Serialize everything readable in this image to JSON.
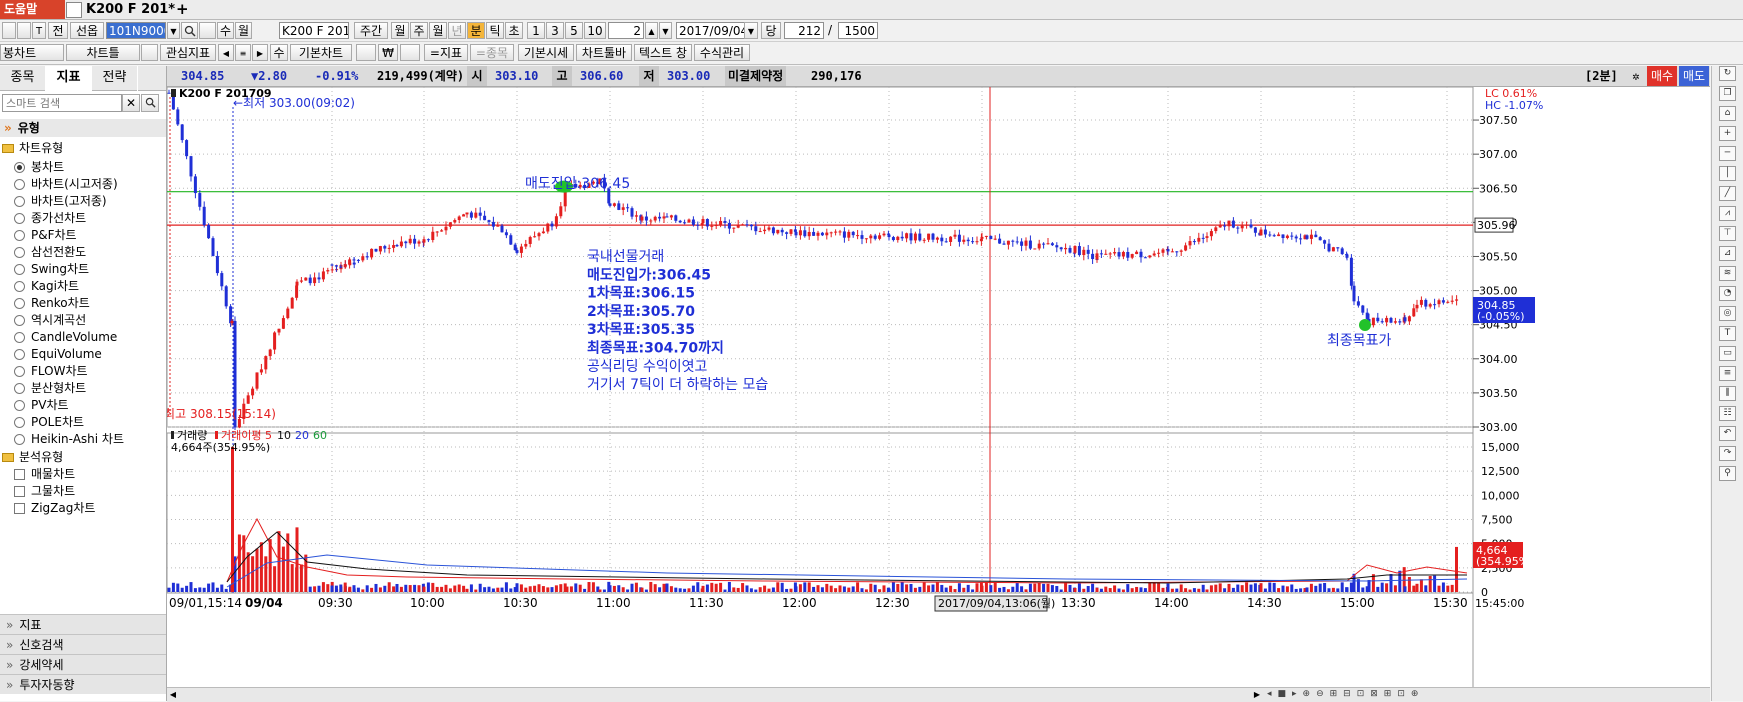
{
  "tabs": {
    "help": "도움말",
    "active": "K200 F 201*",
    "add": "+"
  },
  "toolbar1": {
    "symbol_value": "101N9000",
    "symbol_name": "K200 F 201",
    "period_week": "주간",
    "unit_month": "월",
    "unit_week": "주",
    "unit_day": "월",
    "unit_year": "년",
    "unit_minute": "분",
    "unit_tick": "틱",
    "unit_second": "초",
    "n1": "1",
    "n3": "3",
    "n5": "5",
    "n10": "10",
    "interval": "2",
    "date": "2017/09/04",
    "dang_label": "당",
    "count": "212",
    "slash": "/",
    "total": "1500",
    "jeon": "전",
    "seonop": "선옵",
    "su": "수",
    "wol": "월"
  },
  "toolbar2": {
    "bongchart": "봉차트",
    "charttools": "차트틀",
    "watchlist": "관심지표",
    "su": "수",
    "basic_chart": "기본차트",
    "indicator": "=지표",
    "item": "=종목",
    "basic_quote": "기본시세",
    "chart_toolbar": "차트툴바",
    "text_window": "텍스트 창",
    "formula": "수식관리"
  },
  "left_panel": {
    "tabs": [
      "종목",
      "지표",
      "전략"
    ],
    "search_placeholder": "스마트 검색",
    "section_type": "유형",
    "group_chart_type": "차트유형",
    "chart_types": [
      "봉차트",
      "바차트(시고저종)",
      "바차트(고저종)",
      "종가선차트",
      "P&F차트",
      "삼선전환도",
      "Swing차트",
      "Kagi차트",
      "Renko차트",
      "역시계곡선",
      "CandleVolume",
      "EquiVolume",
      "FLOW차트",
      "분산형차트",
      "PV차트",
      "POLE차트",
      "Heikin-Ashi 차트"
    ],
    "selected_type": "봉차트",
    "group_analysis": "분석유형",
    "analysis_types": [
      "매물차트",
      "그물차트",
      "ZigZag차트"
    ],
    "bottom_items": [
      "지표",
      "신호검색",
      "강세약세",
      "투자자동향"
    ]
  },
  "infobar": {
    "price": "304.85",
    "change": "▼2.80",
    "change_pct": "-0.91%",
    "volume": "219,499(계약)",
    "open_label": "시",
    "open": "303.10",
    "high_label": "고",
    "high": "306.60",
    "low_label": "저",
    "low": "303.00",
    "oi_label": "미결제약정",
    "oi": "290,176",
    "interval_label": "[2분]",
    "buy": "매수",
    "sell": "매도"
  },
  "colors": {
    "up": "#e41f1f",
    "down": "#1f2fd6",
    "annotation": "#1f2fd6",
    "marker": "#22c22a",
    "hline_green": "#21b521",
    "hline_red": "#e02020",
    "price_tag_bg": "#1f2fd6",
    "volume_tag_bg": "#e41f1f"
  },
  "chart": {
    "symbol_label": "K200 F 201709",
    "low_note": "←최저 303.00(09:02)",
    "high_note": "←최고 308.15(15:14)",
    "entry_label": "매도진입:306.45",
    "target_label": "최종목표가",
    "note_lines": [
      "국내선물거래",
      "매도진입가:306.45",
      "1차목표:306.15",
      "2차목표:305.70",
      "3차목표:305.35",
      "최종목표:304.70까지",
      "공식리딩 수익이엿고",
      "거기서 7틱이 더 하락하는 모습"
    ],
    "lc_label": "LC  0.61%",
    "hc_label": "HC -1.07%",
    "price_axis": [
      "307.50",
      "307.00",
      "306.50",
      "306.00",
      "305.50",
      "305.00",
      "304.50",
      "304.00",
      "303.50",
      "303.00"
    ],
    "red_line_tag": "305.96",
    "current_tag_line1": "304.85",
    "current_tag_line2": "(-0.05%)",
    "volume_legend_label": "거래량",
    "volume_ma_label": "거래이평",
    "volume_ma_periods": [
      "5",
      "10",
      "20",
      "60"
    ],
    "volume_value": "4,664주(354.95%)",
    "volume_axis": [
      "15,000",
      "12,500",
      "10,000",
      "7,500",
      "5,000",
      "2,500",
      "0"
    ],
    "volume_tag_line1": "4,664",
    "volume_tag_line2": "(354.95%)",
    "time_axis": [
      "09/01,15:14",
      "09/04",
      "09:30",
      "10:00",
      "10:30",
      "11:00",
      "11:30",
      "12:00",
      "12:30",
      "13:00",
      "13:30",
      "14:00",
      "14:30",
      "15:00",
      "15:30"
    ],
    "crosshair_label": "2017/09/04,13:06(월)",
    "time_end": "15:45:00"
  },
  "chart_data": {
    "type": "candlestick",
    "interval": "2분",
    "ylim": [
      303.0,
      307.75
    ],
    "volume_ylim": [
      0,
      15000
    ],
    "hlines": [
      306.45,
      305.96
    ],
    "series": [
      {
        "name": "price_path",
        "x": [
          "09/01 15:14",
          "09/04 09:00",
          "09:02",
          "09:10",
          "09:20",
          "09:30",
          "09:45",
          "10:00",
          "10:15",
          "10:25",
          "10:30",
          "10:40",
          "10:45",
          "10:55",
          "11:00",
          "11:10",
          "11:15",
          "11:30",
          "12:00",
          "12:30",
          "13:00",
          "13:30",
          "13:40",
          "14:00",
          "14:15",
          "14:25",
          "14:30",
          "14:45",
          "14:55",
          "15:00",
          "15:05",
          "15:15",
          "15:20",
          "15:30"
        ],
        "values": [
          307.9,
          304.5,
          303.0,
          305.1,
          305.4,
          305.35,
          305.7,
          305.75,
          306.15,
          305.9,
          305.6,
          306.0,
          306.5,
          306.6,
          306.3,
          306.05,
          306.05,
          306.0,
          305.85,
          305.8,
          305.75,
          305.6,
          305.5,
          305.55,
          305.8,
          306.0,
          305.85,
          305.8,
          305.5,
          304.9,
          304.55,
          304.55,
          304.8,
          304.85
        ]
      }
    ]
  }
}
